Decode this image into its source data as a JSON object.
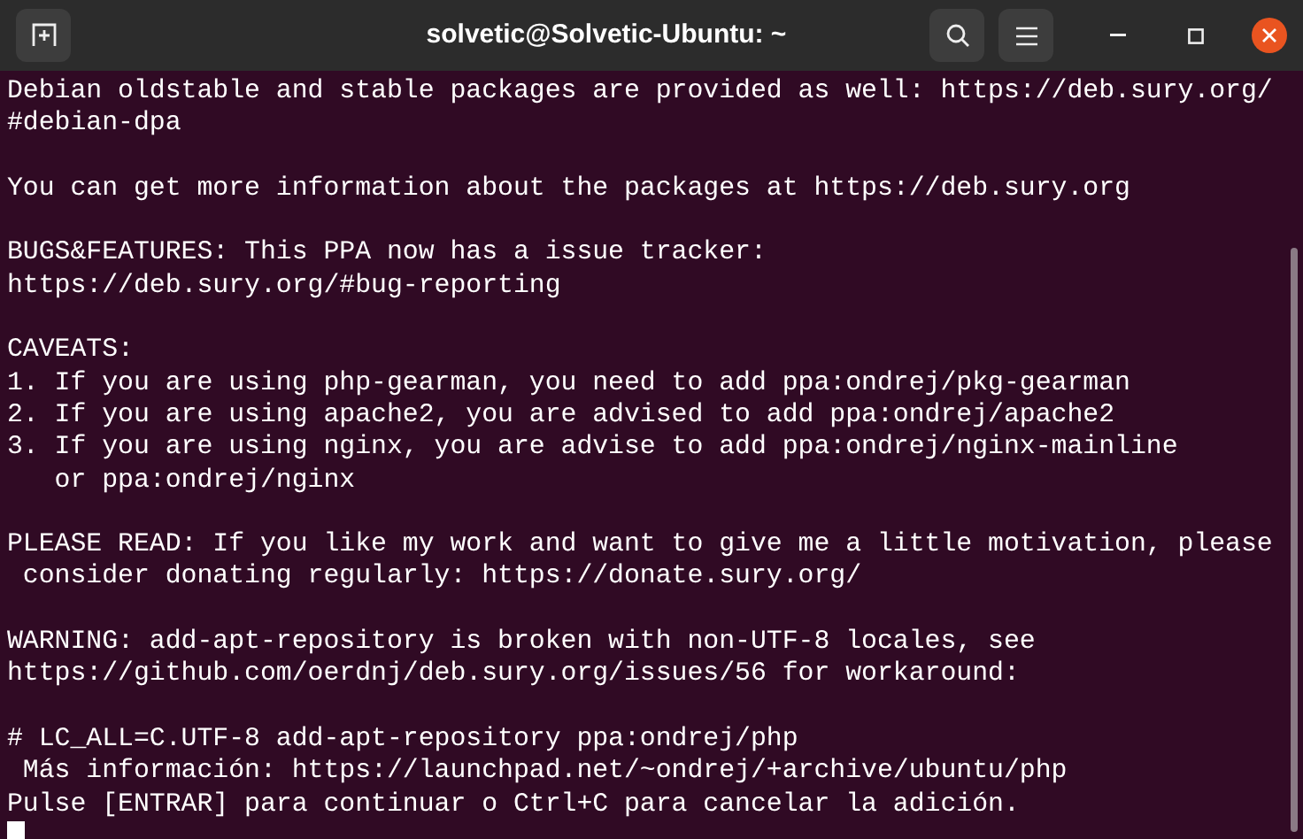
{
  "window": {
    "title": "solvetic@Solvetic-Ubuntu: ~"
  },
  "terminal": {
    "paragraphs": [
      [
        "Debian oldstable and stable packages are provided as well: https://deb.sury.org/",
        "#debian-dpa"
      ],
      [
        "You can get more information about the packages at https://deb.sury.org"
      ],
      [
        "BUGS&FEATURES: This PPA now has a issue tracker:",
        "https://deb.sury.org/#bug-reporting"
      ],
      [
        "CAVEATS:",
        "1. If you are using php-gearman, you need to add ppa:ondrej/pkg-gearman",
        "2. If you are using apache2, you are advised to add ppa:ondrej/apache2",
        "3. If you are using nginx, you are advise to add ppa:ondrej/nginx-mainline",
        "   or ppa:ondrej/nginx"
      ],
      [
        "PLEASE READ: If you like my work and want to give me a little motivation, please",
        " consider donating regularly: https://donate.sury.org/"
      ],
      [
        "WARNING: add-apt-repository is broken with non-UTF-8 locales, see",
        "https://github.com/oerdnj/deb.sury.org/issues/56 for workaround:"
      ],
      [
        "# LC_ALL=C.UTF-8 add-apt-repository ppa:ondrej/php",
        " Más información: https://launchpad.net/~ondrej/+archive/ubuntu/php",
        "Pulse [ENTRAR] para continuar o Ctrl+C para cancelar la adición."
      ]
    ],
    "cursor": true
  }
}
